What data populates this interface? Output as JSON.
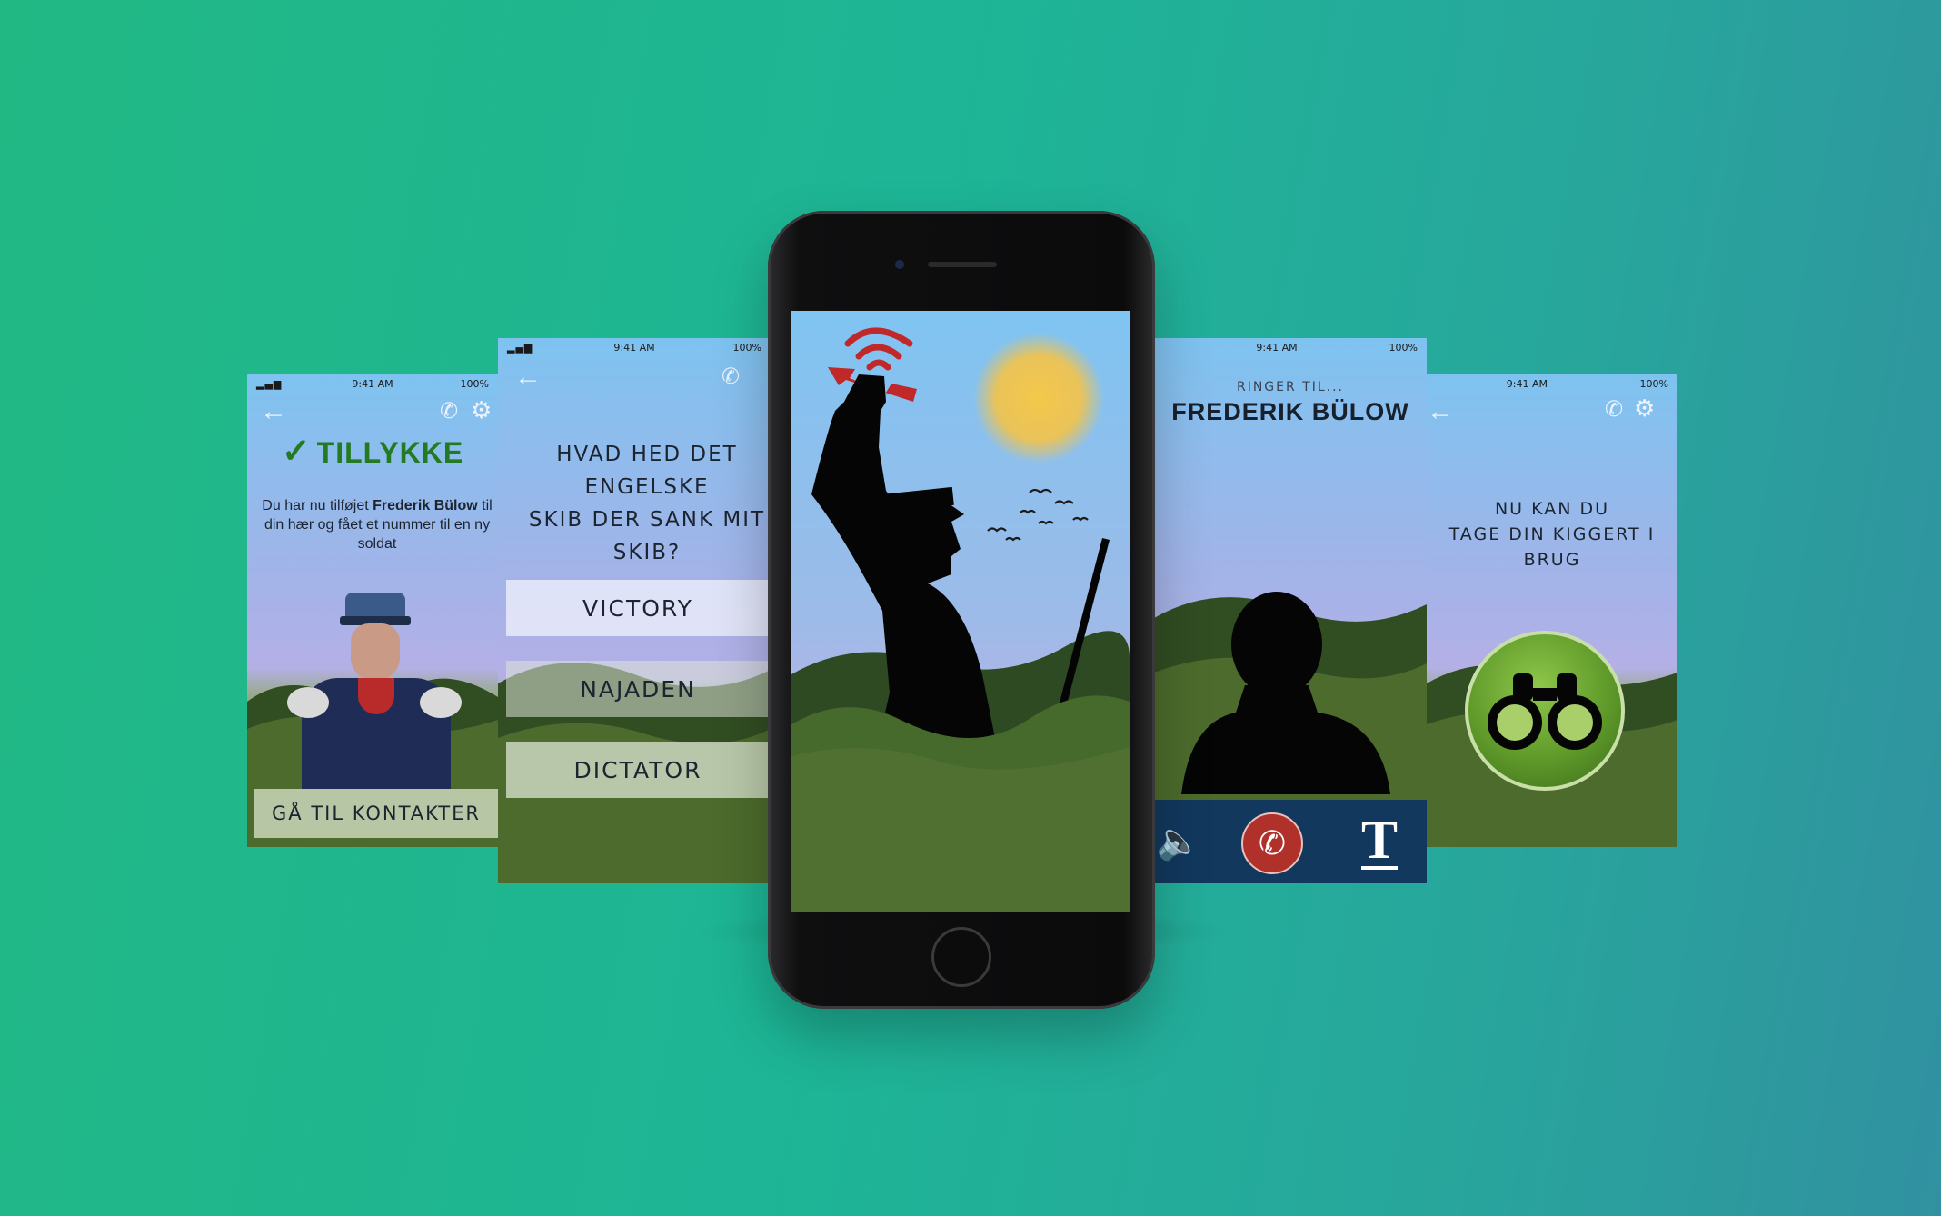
{
  "status": {
    "time": "9:41 AM",
    "battery": "100%"
  },
  "screen1": {
    "title": "TILLYKKE",
    "message_prefix": "Du har nu tilføjet ",
    "message_name": "Frederik Bülow",
    "message_suffix": " til din hær og fået et nummer til en ny soldat",
    "button": "GÅ TIL KONTAKTER"
  },
  "screen2": {
    "question_line1": "HVAD HED DET ENGELSKE",
    "question_line2": "SKIB DER SANK MIT SKIB?",
    "options": [
      "VICTORY",
      "NAJADEN",
      "DICTATOR"
    ]
  },
  "screen4": {
    "calling_label": "RINGER TIL...",
    "caller_name": "FREDERIK BÜLOW",
    "text_button": "T"
  },
  "screen5": {
    "line1": "NU KAN DU",
    "line2": "TAGE DIN KIGGERT I",
    "line3": "BRUG"
  },
  "colors": {
    "accent_green": "#2f8a2a",
    "call_red": "#b0302a",
    "call_bar": "#12385e",
    "binocular_green": "#5f9a2a"
  }
}
